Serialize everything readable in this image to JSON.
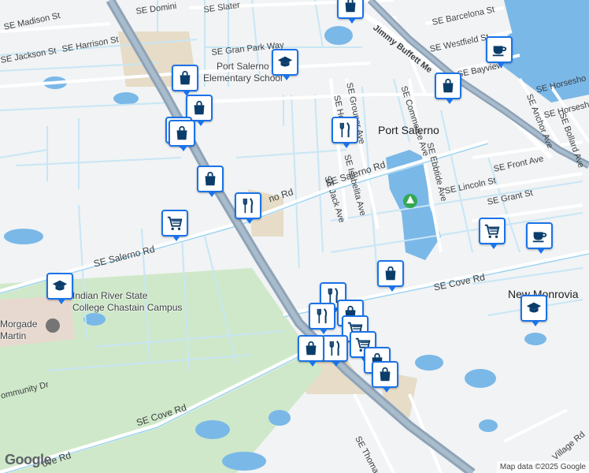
{
  "map": {
    "attribution": "Map data ©2025 Google",
    "logo": "Google",
    "colors": {
      "land": "#f1f3f4",
      "water": "#7ab8e8",
      "park": "#cfe8c9",
      "highway": "#8fa3b8",
      "road": "#ffffff",
      "minor_road": "#c8e6f5",
      "campus": "#e6dcc7"
    }
  },
  "places": {
    "port_salerno": "Port Salerno",
    "new_monrovia": "New Monrovia"
  },
  "pois": {
    "school1": "Port Salerno\nElementary School",
    "college": "Indian River State\nCollege Chastain Campus",
    "morgade": "Morgade\nMartin"
  },
  "streets": {
    "madison": "SE Madison St",
    "jackson": "SE Jackson St",
    "harrison": "SE Harrison St",
    "slater": "SE Slater",
    "dominica": "SE Domini",
    "gran_park": "SE Gran Park Way",
    "jimmy_buffett": "Jimmy Buffett Me",
    "barcelona": "SE Barcelona St",
    "westfield": "SE Westfield St",
    "bayview": "SE Bayview",
    "commerce": "SE Commerce Ave",
    "grouper": "SE Grouper Ave",
    "ho": "SE Ho",
    "salerno_e": "SE Salerno Rd",
    "isabelita": "SE Isabelita Ave",
    "jack": "SE Jack Ave",
    "ebbtide": "SE Ebbtide Ave",
    "lincoln": "SE Lincoln St",
    "front": "SE Front Ave",
    "grant": "SE Grant St",
    "anchor": "SE Anchor Ave",
    "horseshoe_a": "SE Horsesho",
    "horseshoe_b": "SE Horsesho",
    "bollard": "SE Bollard Ave",
    "salerno_mid": "no Rd",
    "salerno_w": "SE Salerno Rd",
    "cove_e": "SE Cove Rd",
    "cove_w": "SE Cove Rd",
    "cove_far": "ove Rd",
    "community": "ommunity Dr",
    "thomas": "SE Thomas",
    "village": "Village Rd"
  },
  "markers": [
    {
      "type": "shopping-icon"
    },
    {
      "type": "school-icon"
    },
    {
      "type": "shopping-icon"
    },
    {
      "type": "shopping-icon"
    },
    {
      "type": "shopping-icon"
    },
    {
      "type": "shopping-icon"
    },
    {
      "type": "cafe-icon"
    },
    {
      "type": "shopping-icon"
    },
    {
      "type": "restaurant-icon"
    },
    {
      "type": "shopping-icon"
    },
    {
      "type": "restaurant-icon"
    },
    {
      "type": "grocery-icon"
    },
    {
      "type": "grocery-icon"
    },
    {
      "type": "cafe-icon"
    },
    {
      "type": "shopping-icon"
    },
    {
      "type": "school-icon"
    },
    {
      "type": "restaurant-icon"
    },
    {
      "type": "school-icon"
    },
    {
      "type": "restaurant-icon"
    },
    {
      "type": "shopping-icon"
    },
    {
      "type": "grocery-icon"
    },
    {
      "type": "restaurant-icon"
    },
    {
      "type": "shopping-icon"
    },
    {
      "type": "grocery-icon"
    },
    {
      "type": "shopping-icon"
    },
    {
      "type": "shopping-icon"
    }
  ]
}
